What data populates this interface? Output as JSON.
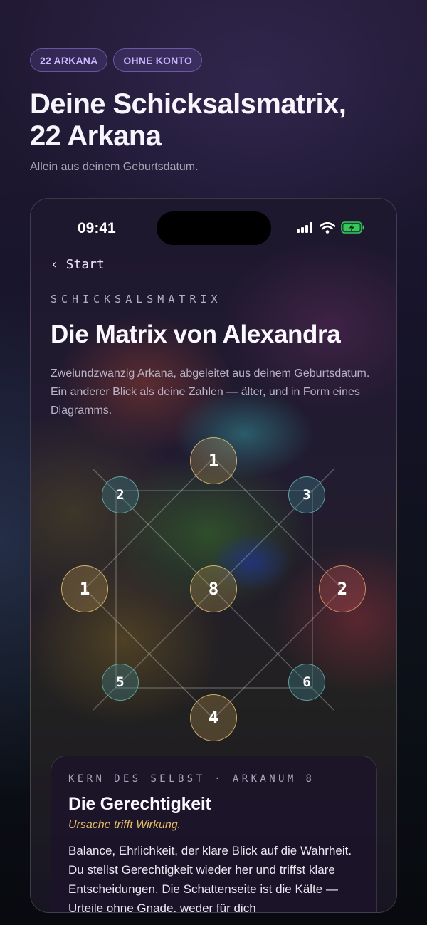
{
  "badges": [
    "22 ARKANA",
    "OHNE KONTO"
  ],
  "headline": {
    "line1": "Deine Schicksalsmatrix,",
    "line2": "22 Arkana"
  },
  "subline": "Allein aus deinem Geburtsdatum.",
  "phone": {
    "status": {
      "time": "09:41"
    },
    "back_label": "‹  Start",
    "overline": "SCHICKSALSMATRIX",
    "title": "Die Matrix von Alexandra",
    "intro": "Zweiundzwanzig Arkana, abgeleitet aus deinem Geburtsdatum. Ein anderer Blick als deine Zahlen — älter, und in Form eines Diagramms.",
    "matrix": {
      "top": "1",
      "top_left": "2",
      "top_right": "3",
      "left": "1",
      "center": "8",
      "right": "2",
      "bottom_left": "5",
      "bottom_right": "6",
      "bottom": "4"
    },
    "card": {
      "overline": "KERN DES SELBST · ARKANUM 8",
      "title": "Die Gerechtigkeit",
      "tagline": "Ursache trifft Wirkung.",
      "body": "Balance, Ehrlichkeit, der klare Blick auf die Wahrheit. Du stellst Gerechtigkeit wieder her und triffst klare Entscheidungen. Die Schattenseite ist die Kälte — Urteile ohne Gnade, weder für dich"
    }
  },
  "colors": {
    "accent_badge": "#c9b6ff",
    "gold": "#e6bf66",
    "teal": "#78d2c8"
  },
  "icons": [
    "signal-icon",
    "wifi-icon",
    "battery-charging-icon",
    "chevron-left-icon"
  ]
}
